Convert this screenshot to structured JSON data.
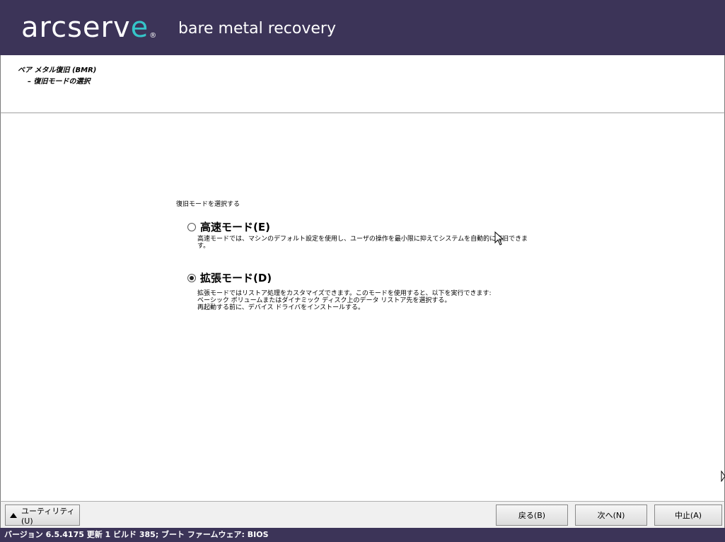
{
  "header": {
    "logo_main": "arcserv",
    "logo_accent": "e",
    "logo_reg": "®",
    "product": "bare metal recovery"
  },
  "breadcrumb": {
    "level1": "ベア メタル復旧 (BMR)",
    "level2": "– 復旧モードの選択"
  },
  "main": {
    "prompt": "復旧モードを選択する",
    "options": [
      {
        "label": "高速モード(E)",
        "selected": false,
        "description": [
          "高速モードでは、マシンのデフォルト設定を使用し、ユーザの操作を最小限に抑えてシステムを自動的に復旧できま",
          "す。"
        ]
      },
      {
        "label": "拡張モード(D)",
        "selected": true,
        "description": [
          "拡張モードではリストア処理をカスタマイズできます。このモードを使用すると、以下を実行できます:",
          "ベーシック ボリュームまたはダイナミック ディスク上のデータ リストア先を選択する。",
          "再起動する前に、デバイス ドライバをインストールする。"
        ]
      }
    ]
  },
  "footer": {
    "utility_label": "ユーティリティ(U)",
    "back_label": "戻る(B)",
    "next_label": "次へ(N)",
    "cancel_label": "中止(A)"
  },
  "status": {
    "text": "バージョン 6.5.4175 更新 1 ビルド 385; ブート ファームウェア: BIOS"
  },
  "colors": {
    "brand_bg": "#3c3458",
    "accent": "#35c5c9"
  }
}
